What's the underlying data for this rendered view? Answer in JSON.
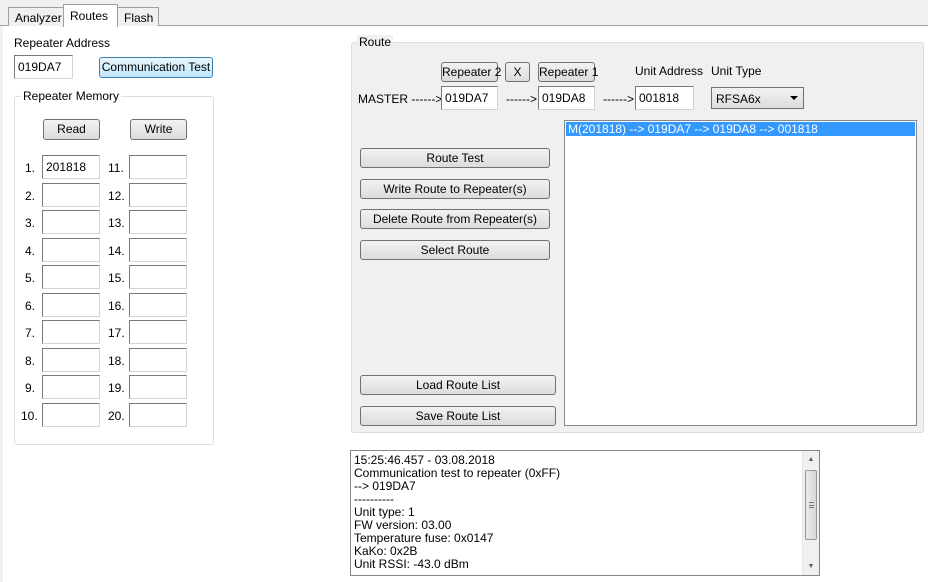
{
  "tabs": [
    {
      "label": "Analyzer"
    },
    {
      "label": "Routes"
    },
    {
      "label": "Flash"
    }
  ],
  "repeater": {
    "address_label": "Repeater Address",
    "address_value": "019DA7",
    "comm_test_label": "Communication Test",
    "memory": {
      "title": "Repeater Memory",
      "read_label": "Read",
      "write_label": "Write",
      "rows": [
        {
          "left_num": "1.",
          "left_value": "201818",
          "right_num": "11.",
          "right_value": ""
        },
        {
          "left_num": "2.",
          "left_value": "",
          "right_num": "12.",
          "right_value": ""
        },
        {
          "left_num": "3.",
          "left_value": "",
          "right_num": "13.",
          "right_value": ""
        },
        {
          "left_num": "4.",
          "left_value": "",
          "right_num": "14.",
          "right_value": ""
        },
        {
          "left_num": "5.",
          "left_value": "",
          "right_num": "15.",
          "right_value": ""
        },
        {
          "left_num": "6.",
          "left_value": "",
          "right_num": "16.",
          "right_value": ""
        },
        {
          "left_num": "7.",
          "left_value": "",
          "right_num": "17.",
          "right_value": ""
        },
        {
          "left_num": "8.",
          "left_value": "",
          "right_num": "18.",
          "right_value": ""
        },
        {
          "left_num": "9.",
          "left_value": "",
          "right_num": "19.",
          "right_value": ""
        },
        {
          "left_num": "10.",
          "left_value": "",
          "right_num": "20.",
          "right_value": ""
        }
      ]
    }
  },
  "route": {
    "title": "Route",
    "repeater2_label": "Repeater 2",
    "x_label": "X",
    "repeater1_label": "Repeater 1",
    "unit_address_label": "Unit Address",
    "unit_type_label": "Unit Type",
    "master_label": "MASTER ------>",
    "arrow1": "------>",
    "arrow2": "------>",
    "repeater2_value": "019DA7",
    "repeater1_value": "019DA8",
    "unit_address_value": "001818",
    "unit_type_value": "RFSA6x",
    "buttons": {
      "route_test": "Route Test",
      "write_route": "Write Route to Repeater(s)",
      "delete_route": "Delete Route from Repeater(s)",
      "select_route": "Select Route",
      "load_list": "Load Route List",
      "save_list": "Save Route List"
    },
    "list": [
      {
        "text": "M(201818) --> 019DA7 --> 019DA8 --> 001818",
        "selected": true
      }
    ]
  },
  "log": {
    "lines": [
      "15:25:46.457 - 03.08.2018",
      "Communication test to repeater (0xFF)",
      "--> 019DA7",
      "----------",
      "Unit type: 1",
      "FW version: 03.00",
      "Temperature fuse: 0x0147",
      "KaKo: 0x2B",
      "Unit RSSI: -43.0 dBm"
    ]
  }
}
